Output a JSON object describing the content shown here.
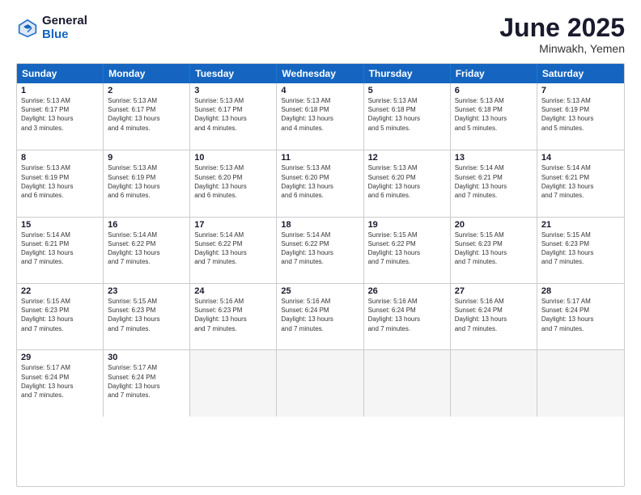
{
  "logo": {
    "general": "General",
    "blue": "Blue"
  },
  "title": {
    "month": "June 2025",
    "location": "Minwakh, Yemen"
  },
  "header_days": [
    "Sunday",
    "Monday",
    "Tuesday",
    "Wednesday",
    "Thursday",
    "Friday",
    "Saturday"
  ],
  "weeks": [
    [
      {
        "day": "1",
        "info": "Sunrise: 5:13 AM\nSunset: 6:17 PM\nDaylight: 13 hours\nand 3 minutes."
      },
      {
        "day": "2",
        "info": "Sunrise: 5:13 AM\nSunset: 6:17 PM\nDaylight: 13 hours\nand 4 minutes."
      },
      {
        "day": "3",
        "info": "Sunrise: 5:13 AM\nSunset: 6:17 PM\nDaylight: 13 hours\nand 4 minutes."
      },
      {
        "day": "4",
        "info": "Sunrise: 5:13 AM\nSunset: 6:18 PM\nDaylight: 13 hours\nand 4 minutes."
      },
      {
        "day": "5",
        "info": "Sunrise: 5:13 AM\nSunset: 6:18 PM\nDaylight: 13 hours\nand 5 minutes."
      },
      {
        "day": "6",
        "info": "Sunrise: 5:13 AM\nSunset: 6:18 PM\nDaylight: 13 hours\nand 5 minutes."
      },
      {
        "day": "7",
        "info": "Sunrise: 5:13 AM\nSunset: 6:19 PM\nDaylight: 13 hours\nand 5 minutes."
      }
    ],
    [
      {
        "day": "8",
        "info": "Sunrise: 5:13 AM\nSunset: 6:19 PM\nDaylight: 13 hours\nand 6 minutes."
      },
      {
        "day": "9",
        "info": "Sunrise: 5:13 AM\nSunset: 6:19 PM\nDaylight: 13 hours\nand 6 minutes."
      },
      {
        "day": "10",
        "info": "Sunrise: 5:13 AM\nSunset: 6:20 PM\nDaylight: 13 hours\nand 6 minutes."
      },
      {
        "day": "11",
        "info": "Sunrise: 5:13 AM\nSunset: 6:20 PM\nDaylight: 13 hours\nand 6 minutes."
      },
      {
        "day": "12",
        "info": "Sunrise: 5:13 AM\nSunset: 6:20 PM\nDaylight: 13 hours\nand 6 minutes."
      },
      {
        "day": "13",
        "info": "Sunrise: 5:14 AM\nSunset: 6:21 PM\nDaylight: 13 hours\nand 7 minutes."
      },
      {
        "day": "14",
        "info": "Sunrise: 5:14 AM\nSunset: 6:21 PM\nDaylight: 13 hours\nand 7 minutes."
      }
    ],
    [
      {
        "day": "15",
        "info": "Sunrise: 5:14 AM\nSunset: 6:21 PM\nDaylight: 13 hours\nand 7 minutes."
      },
      {
        "day": "16",
        "info": "Sunrise: 5:14 AM\nSunset: 6:22 PM\nDaylight: 13 hours\nand 7 minutes."
      },
      {
        "day": "17",
        "info": "Sunrise: 5:14 AM\nSunset: 6:22 PM\nDaylight: 13 hours\nand 7 minutes."
      },
      {
        "day": "18",
        "info": "Sunrise: 5:14 AM\nSunset: 6:22 PM\nDaylight: 13 hours\nand 7 minutes."
      },
      {
        "day": "19",
        "info": "Sunrise: 5:15 AM\nSunset: 6:22 PM\nDaylight: 13 hours\nand 7 minutes."
      },
      {
        "day": "20",
        "info": "Sunrise: 5:15 AM\nSunset: 6:23 PM\nDaylight: 13 hours\nand 7 minutes."
      },
      {
        "day": "21",
        "info": "Sunrise: 5:15 AM\nSunset: 6:23 PM\nDaylight: 13 hours\nand 7 minutes."
      }
    ],
    [
      {
        "day": "22",
        "info": "Sunrise: 5:15 AM\nSunset: 6:23 PM\nDaylight: 13 hours\nand 7 minutes."
      },
      {
        "day": "23",
        "info": "Sunrise: 5:15 AM\nSunset: 6:23 PM\nDaylight: 13 hours\nand 7 minutes."
      },
      {
        "day": "24",
        "info": "Sunrise: 5:16 AM\nSunset: 6:23 PM\nDaylight: 13 hours\nand 7 minutes."
      },
      {
        "day": "25",
        "info": "Sunrise: 5:16 AM\nSunset: 6:24 PM\nDaylight: 13 hours\nand 7 minutes."
      },
      {
        "day": "26",
        "info": "Sunrise: 5:16 AM\nSunset: 6:24 PM\nDaylight: 13 hours\nand 7 minutes."
      },
      {
        "day": "27",
        "info": "Sunrise: 5:16 AM\nSunset: 6:24 PM\nDaylight: 13 hours\nand 7 minutes."
      },
      {
        "day": "28",
        "info": "Sunrise: 5:17 AM\nSunset: 6:24 PM\nDaylight: 13 hours\nand 7 minutes."
      }
    ],
    [
      {
        "day": "29",
        "info": "Sunrise: 5:17 AM\nSunset: 6:24 PM\nDaylight: 13 hours\nand 7 minutes."
      },
      {
        "day": "30",
        "info": "Sunrise: 5:17 AM\nSunset: 6:24 PM\nDaylight: 13 hours\nand 7 minutes."
      },
      {
        "day": "",
        "info": ""
      },
      {
        "day": "",
        "info": ""
      },
      {
        "day": "",
        "info": ""
      },
      {
        "day": "",
        "info": ""
      },
      {
        "day": "",
        "info": ""
      }
    ]
  ]
}
